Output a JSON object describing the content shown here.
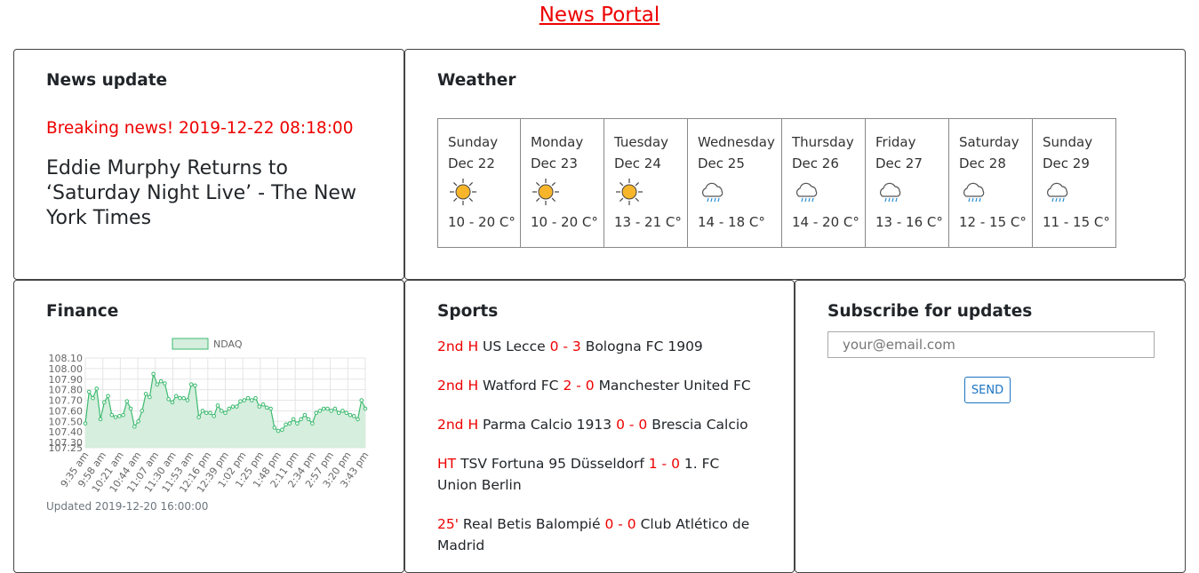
{
  "page_title": "News Portal",
  "news": {
    "heading": "News update",
    "breaking": "Breaking news! 2019-12-22 08:18:00",
    "headline": "Eddie Murphy Returns to ‘Saturday Night Live’ - The New York Times"
  },
  "weather": {
    "heading": "Weather",
    "days": [
      {
        "day": "Sunday",
        "date": "Dec 22",
        "icon": "sun-icon",
        "temp": "10 - 20 C°"
      },
      {
        "day": "Monday",
        "date": "Dec 23",
        "icon": "sun-icon",
        "temp": "10 - 20 C°"
      },
      {
        "day": "Tuesday",
        "date": "Dec 24",
        "icon": "sun-icon",
        "temp": "13 - 21 C°"
      },
      {
        "day": "Wednesday",
        "date": "Dec 25",
        "icon": "rain-cloud-icon",
        "temp": "14 - 18 C°"
      },
      {
        "day": "Thursday",
        "date": "Dec 26",
        "icon": "rain-cloud-icon",
        "temp": "14 - 20 C°"
      },
      {
        "day": "Friday",
        "date": "Dec 27",
        "icon": "rain-cloud-icon",
        "temp": "13 - 16 C°"
      },
      {
        "day": "Saturday",
        "date": "Dec 28",
        "icon": "rain-cloud-icon",
        "temp": "12 - 15 C°"
      },
      {
        "day": "Sunday",
        "date": "Dec 29",
        "icon": "rain-cloud-icon",
        "temp": "11 - 15 C°"
      }
    ]
  },
  "finance": {
    "heading": "Finance",
    "updated": "Updated 2019-12-20 16:00:00"
  },
  "chart_data": {
    "type": "area",
    "series": [
      {
        "name": "NDAQ",
        "color": "#3cba6f",
        "fill": "#d5eedd"
      }
    ],
    "legend": "top",
    "y_ticks": [
      "108.10",
      "108.00",
      "107.90",
      "107.80",
      "107.70",
      "107.60",
      "107.50",
      "107.40",
      "107.30",
      "107.25"
    ],
    "ylim": [
      107.25,
      108.1
    ],
    "x_ticks": [
      "9:35 am",
      "9:58 am",
      "10:21 am",
      "10:44 am",
      "11:07 am",
      "11:30 am",
      "11:53 am",
      "12:16 pm",
      "12:39 pm",
      "1:02 pm",
      "1:25 pm",
      "1:48 pm",
      "2:11 pm",
      "2:34 pm",
      "2:57 pm",
      "3:20 pm",
      "3:43 pm"
    ],
    "values": [
      107.48,
      107.78,
      107.72,
      107.81,
      107.52,
      107.68,
      107.74,
      107.56,
      107.54,
      107.55,
      107.56,
      107.69,
      107.62,
      107.45,
      107.5,
      107.6,
      107.76,
      107.73,
      107.95,
      107.85,
      107.88,
      107.86,
      107.71,
      107.68,
      107.74,
      107.72,
      107.72,
      107.7,
      107.85,
      107.84,
      107.54,
      107.6,
      107.58,
      107.58,
      107.55,
      107.65,
      107.6,
      107.58,
      107.62,
      107.64,
      107.64,
      107.69,
      107.7,
      107.72,
      107.7,
      107.72,
      107.64,
      107.66,
      107.63,
      107.62,
      107.44,
      107.41,
      107.42,
      107.47,
      107.48,
      107.52,
      107.48,
      107.52,
      107.56,
      107.52,
      107.48,
      107.58,
      107.6,
      107.62,
      107.62,
      107.6,
      107.62,
      107.58,
      107.6,
      107.58,
      107.56,
      107.55,
      107.52,
      107.7,
      107.62
    ],
    "grid": true
  },
  "sports": {
    "heading": "Sports",
    "matches": [
      {
        "status": "2nd H",
        "home": "US Lecce",
        "score": "0 - 3",
        "away": "Bologna FC 1909"
      },
      {
        "status": "2nd H",
        "home": "Watford FC",
        "score": "2 - 0",
        "away": "Manchester United FC"
      },
      {
        "status": "2nd H",
        "home": "Parma Calcio 1913",
        "score": "0 - 0",
        "away": "Brescia Calcio"
      },
      {
        "status": "HT",
        "home": "TSV Fortuna 95 Düsseldorf",
        "score": "1 - 0",
        "away": "1. FC Union Berlin"
      },
      {
        "status": "25'",
        "home": "Real Betis Balompié",
        "score": "0 - 0",
        "away": "Club Atlético de Madrid"
      }
    ]
  },
  "subscribe": {
    "heading": "Subscribe for updates",
    "placeholder": "your@email.com",
    "button": "SEND"
  }
}
